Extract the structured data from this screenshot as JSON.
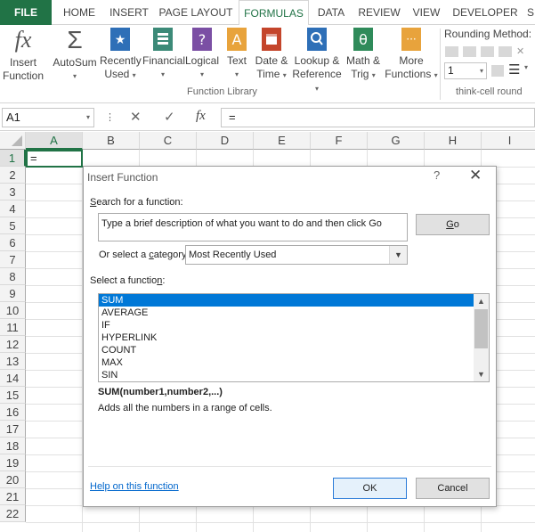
{
  "tabs": [
    "FILE",
    "HOME",
    "INSERT",
    "PAGE LAYOUT",
    "FORMULAS",
    "DATA",
    "REVIEW",
    "VIEW",
    "DEVELOPER",
    "S"
  ],
  "ribbon": {
    "insert_function": {
      "line1": "Insert",
      "line2": "Function",
      "glyph": "fx"
    },
    "autosum": {
      "line1": "AutoSum",
      "glyph": "Σ"
    },
    "recently_used": {
      "line1": "Recently",
      "line2": "Used"
    },
    "financial": {
      "line1": "Financial"
    },
    "logical": {
      "line1": "Logical",
      "glyph": "?"
    },
    "text": {
      "line1": "Text",
      "glyph": "A"
    },
    "date_time": {
      "line1": "Date &",
      "line2": "Time"
    },
    "lookup": {
      "line1": "Lookup &",
      "line2": "Reference"
    },
    "math": {
      "line1": "Math &",
      "line2": "Trig",
      "glyph": "θ"
    },
    "more": {
      "line1": "More",
      "line2": "Functions",
      "glyph": "···"
    },
    "function_library_label": "Function Library",
    "rounding_label": "Rounding Method:",
    "rounding_value": "1",
    "thinkcell_label": "think-cell round",
    "colors": {
      "accent": "#217346",
      "blue": "#2e6fb7",
      "teal": "#3c8a78",
      "purple": "#7b4fa4",
      "orange": "#e8a33c",
      "red": "#c4452b",
      "green": "#2f8b5a"
    }
  },
  "formula_bar": {
    "name_box": "A1",
    "cancel_glyph": "✕",
    "enter_glyph": "✓",
    "fx_glyph": "fx",
    "content": "="
  },
  "grid": {
    "columns": [
      "A",
      "B",
      "C",
      "D",
      "E",
      "F",
      "G",
      "H",
      "I"
    ],
    "rows": [
      "1",
      "2",
      "3",
      "4",
      "5",
      "6",
      "7",
      "8",
      "9",
      "10",
      "11",
      "12",
      "13",
      "14",
      "15",
      "16",
      "17",
      "18",
      "19",
      "20",
      "21",
      "22"
    ],
    "cell_a1": "="
  },
  "dialog": {
    "title": "Insert Function",
    "help_glyph": "?",
    "close_glyph": "✕",
    "search_label_u": "S",
    "search_label_rest": "earch for a function:",
    "search_text": "Type a brief description of what you want to do and then click Go",
    "go_label_u": "G",
    "go_label_rest": "o",
    "category_label_pre": "Or select a ",
    "category_label_u": "c",
    "category_label_post": "ategory:",
    "category_value": "Most Recently Used",
    "function_label_pre": "Select a functio",
    "function_label_u": "n",
    "function_label_post": ":",
    "functions": [
      "SUM",
      "AVERAGE",
      "IF",
      "HYPERLINK",
      "COUNT",
      "MAX",
      "SIN"
    ],
    "selected_function": "SUM",
    "signature": "SUM(number1,number2,...)",
    "description": "Adds all the numbers in a range of cells.",
    "help_link": "Help on this function",
    "ok_label": "OK",
    "cancel_label": "Cancel"
  }
}
